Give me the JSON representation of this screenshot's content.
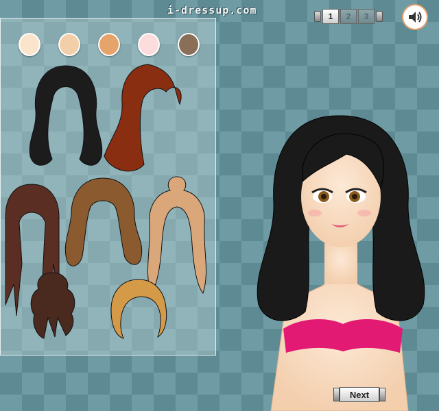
{
  "header": {
    "site_name": "i-dressup.com"
  },
  "pages": {
    "items": [
      "1",
      "2",
      "3"
    ],
    "active": "1"
  },
  "skin_tones": [
    "#fbe4cc",
    "#f2cfa8",
    "#e6a46a",
    "#fcdcdc",
    "#8a6e58"
  ],
  "hair_options": [
    {
      "style": "long-wavy",
      "color": "#1c1c1c"
    },
    {
      "style": "side-swept",
      "color": "#8a2e12"
    },
    {
      "style": "straight-bangs",
      "color": "#5a2e22"
    },
    {
      "style": "medium-wavy",
      "color": "#8b5a2e"
    },
    {
      "style": "top-knot",
      "color": "#d9a77a"
    },
    {
      "style": "messy-bun",
      "color": "#4a2a1e"
    },
    {
      "style": "short-bob",
      "color": "#d49a48"
    }
  ],
  "model": {
    "hair_color": "#1a1a1a",
    "top_color": "#e21a74"
  },
  "footer": {
    "next_label": "Next"
  }
}
